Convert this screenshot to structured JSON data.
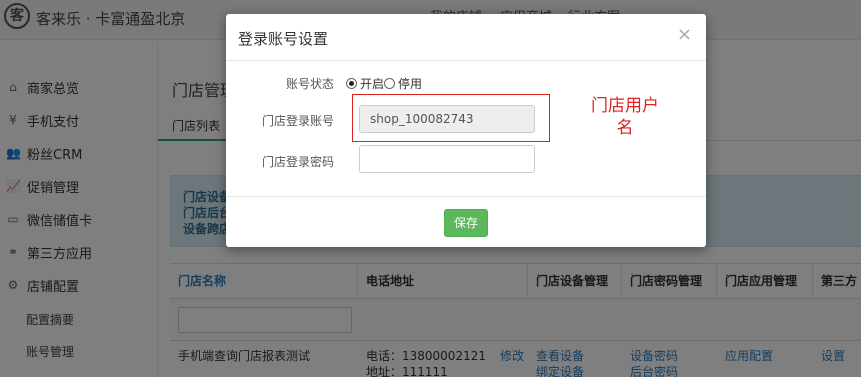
{
  "header": {
    "logo_glyph": "客",
    "brand": "客来乐 · 卡富通盈北京",
    "nav": [
      "我的店铺",
      "应用商城",
      "行业方案"
    ]
  },
  "sidebar": {
    "items": [
      {
        "icon": "home-icon",
        "label": "商家总览"
      },
      {
        "icon": "yen-icon",
        "label": "手机支付"
      },
      {
        "icon": "users-icon",
        "label": "粉丝CRM"
      },
      {
        "icon": "chart-icon",
        "label": "促销管理"
      },
      {
        "icon": "card-icon",
        "label": "微信储值卡"
      },
      {
        "icon": "share-icon",
        "label": "第三方应用"
      },
      {
        "icon": "gears-icon",
        "label": "店铺配置"
      }
    ],
    "subitems": [
      "配置摘要",
      "账号管理"
    ]
  },
  "main": {
    "title": "门店管理",
    "tab": "门店列表",
    "alert_lines": [
      "门店设备",
      "门店后台",
      "设备跨店"
    ],
    "table": {
      "headers": [
        "门店名称",
        "电话地址",
        "门店设备管理",
        "门店密码管理",
        "门店应用管理",
        "第三方门"
      ],
      "row": {
        "name": "手机端查询门店报表测试",
        "phone": "电话：13800002121",
        "address": "地址：111111",
        "edit": "修改",
        "device_links": [
          "查看设备",
          "绑定设备"
        ],
        "password_links": [
          "设备密码",
          "后台密码"
        ],
        "app_link": "应用配置",
        "third_link": "设置"
      }
    }
  },
  "modal": {
    "title": "登录账号设置",
    "close": "×",
    "status_label": "账号状态",
    "status_on": "开启",
    "status_off": "停用",
    "account_label": "门店登录账号",
    "account_value": "shop_100082743",
    "password_label": "门店登录密码",
    "password_value": "",
    "save": "保存"
  },
  "annotation": {
    "text": "门店用户名",
    "color": "#dd2222"
  }
}
